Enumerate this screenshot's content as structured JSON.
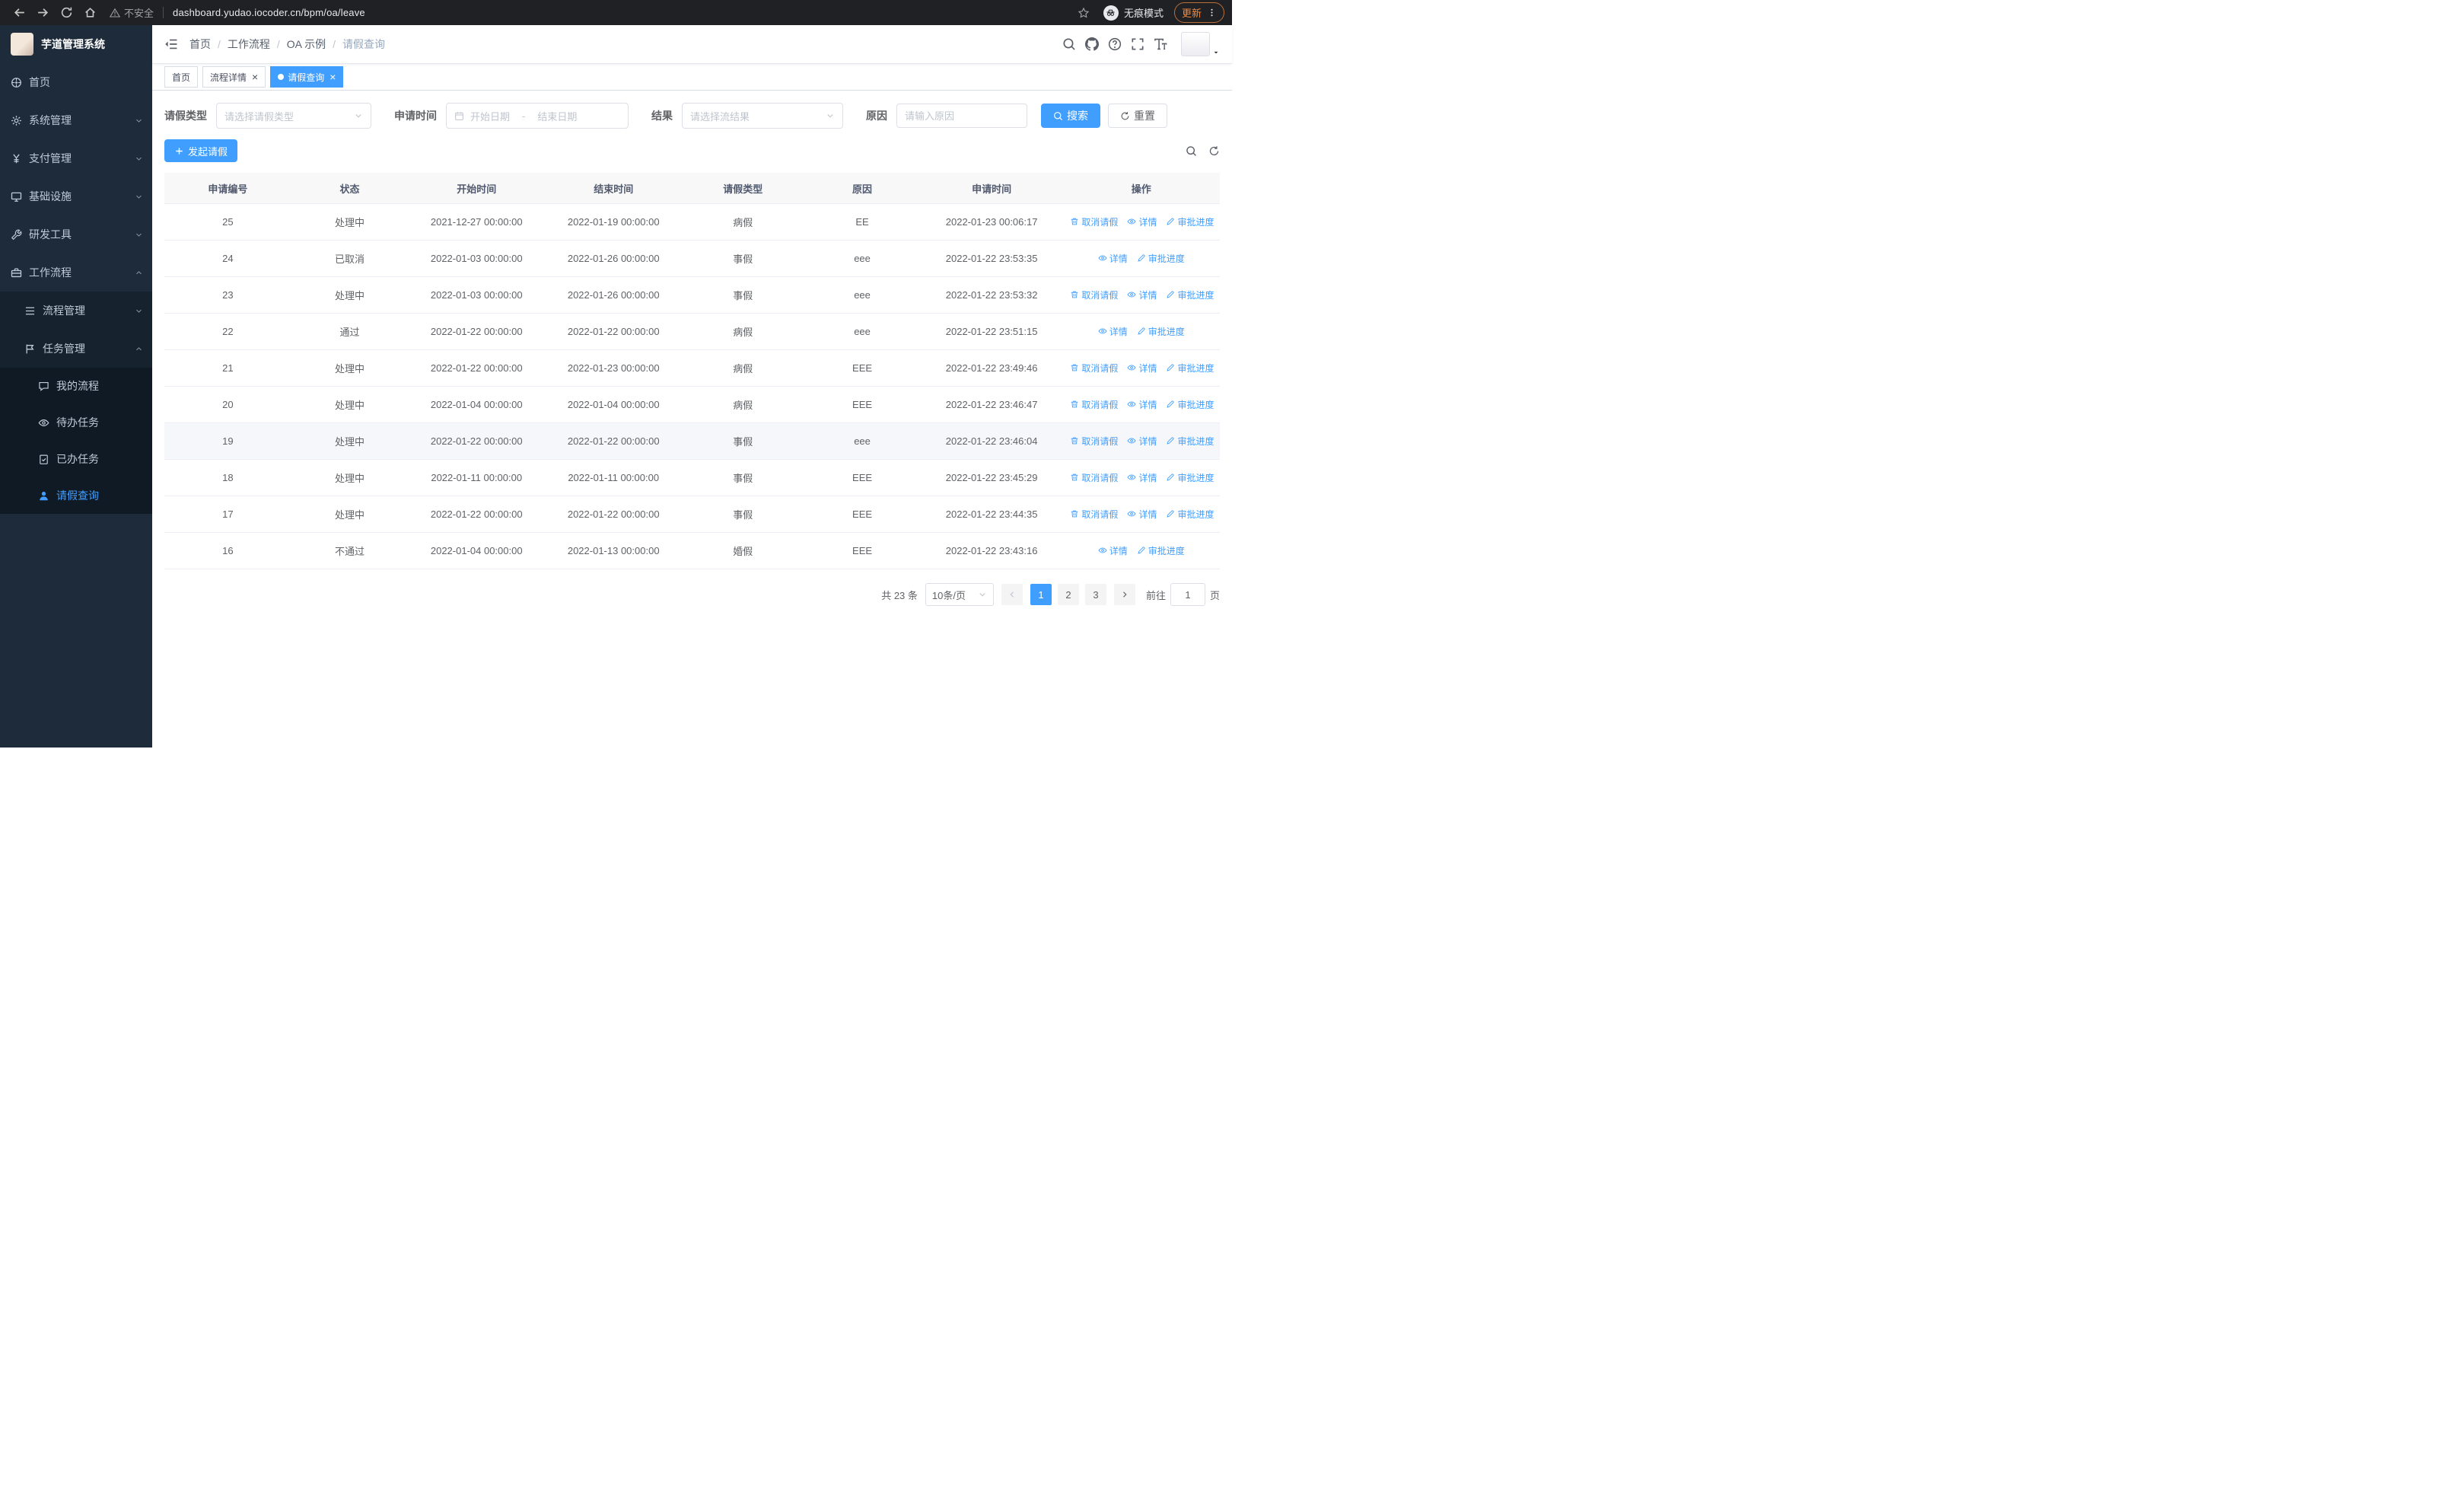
{
  "browser": {
    "security_warning": "不安全",
    "url": "dashboard.yudao.iocoder.cn/bpm/oa/leave",
    "incognito_label": "无痕模式",
    "update_label": "更新"
  },
  "sidebar": {
    "logo_title": "芋道管理系统",
    "items": [
      {
        "key": "home",
        "label": "首页",
        "icon": "dashboard-icon",
        "level": 1
      },
      {
        "key": "system",
        "label": "系统管理",
        "icon": "gear-icon",
        "level": 1,
        "expandable": true,
        "expanded": false
      },
      {
        "key": "payment",
        "label": "支付管理",
        "icon": "yen-icon",
        "level": 1,
        "expandable": true,
        "expanded": false
      },
      {
        "key": "infrastructure",
        "label": "基础设施",
        "icon": "monitor-icon",
        "level": 1,
        "expandable": true,
        "expanded": false
      },
      {
        "key": "dev-tools",
        "label": "研发工具",
        "icon": "wrench-icon",
        "level": 1,
        "expandable": true,
        "expanded": false
      },
      {
        "key": "workflow",
        "label": "工作流程",
        "icon": "briefcase-icon",
        "level": 1,
        "expandable": true,
        "expanded": true
      },
      {
        "key": "process-management",
        "label": "流程管理",
        "icon": "list-icon",
        "level": 2,
        "expandable": true,
        "expanded": false
      },
      {
        "key": "task-management",
        "label": "任务管理",
        "icon": "flag-icon",
        "level": 2,
        "expandable": true,
        "expanded": true
      },
      {
        "key": "my-process",
        "label": "我的流程",
        "icon": "chat-icon",
        "level": 3
      },
      {
        "key": "todo-tasks",
        "label": "待办任务",
        "icon": "eye-icon",
        "level": 3
      },
      {
        "key": "done-tasks",
        "label": "已办任务",
        "icon": "clipboard-check-icon",
        "level": 3
      },
      {
        "key": "leave-query",
        "label": "请假查询",
        "icon": "user-icon",
        "level": 3,
        "active": true
      }
    ]
  },
  "header": {
    "breadcrumb": [
      "首页",
      "工作流程",
      "OA 示例",
      "请假查询"
    ]
  },
  "tabs": [
    {
      "label": "首页",
      "closable": false,
      "active": false
    },
    {
      "label": "流程详情",
      "closable": true,
      "active": false
    },
    {
      "label": "请假查询",
      "closable": true,
      "active": true
    }
  ],
  "filters": {
    "leave_type_label": "请假类型",
    "leave_type_placeholder": "请选择请假类型",
    "apply_time_label": "申请时间",
    "start_date_placeholder": "开始日期",
    "range_separator": "-",
    "end_date_placeholder": "结束日期",
    "result_label": "结果",
    "result_placeholder": "请选择流结果",
    "reason_label": "原因",
    "reason_placeholder": "请输入原因",
    "search_label": "搜索",
    "reset_label": "重置"
  },
  "toolbar": {
    "create_label": "发起请假"
  },
  "table": {
    "headers": [
      "申请编号",
      "状态",
      "开始时间",
      "结束时间",
      "请假类型",
      "原因",
      "申请时间",
      "操作"
    ],
    "actions": {
      "cancel": "取消请假",
      "detail": "详情",
      "progress": "审批进度"
    },
    "rows": [
      {
        "id": "25",
        "status": "处理中",
        "start": "2021-12-27 00:00:00",
        "end": "2022-01-19 00:00:00",
        "type": "病假",
        "reason": "EE",
        "applied": "2022-01-23 00:06:17",
        "can_cancel": true
      },
      {
        "id": "24",
        "status": "已取消",
        "start": "2022-01-03 00:00:00",
        "end": "2022-01-26 00:00:00",
        "type": "事假",
        "reason": "eee",
        "applied": "2022-01-22 23:53:35",
        "can_cancel": false
      },
      {
        "id": "23",
        "status": "处理中",
        "start": "2022-01-03 00:00:00",
        "end": "2022-01-26 00:00:00",
        "type": "事假",
        "reason": "eee",
        "applied": "2022-01-22 23:53:32",
        "can_cancel": true
      },
      {
        "id": "22",
        "status": "通过",
        "start": "2022-01-22 00:00:00",
        "end": "2022-01-22 00:00:00",
        "type": "病假",
        "reason": "eee",
        "applied": "2022-01-22 23:51:15",
        "can_cancel": false
      },
      {
        "id": "21",
        "status": "处理中",
        "start": "2022-01-22 00:00:00",
        "end": "2022-01-23 00:00:00",
        "type": "病假",
        "reason": "EEE",
        "applied": "2022-01-22 23:49:46",
        "can_cancel": true
      },
      {
        "id": "20",
        "status": "处理中",
        "start": "2022-01-04 00:00:00",
        "end": "2022-01-04 00:00:00",
        "type": "病假",
        "reason": "EEE",
        "applied": "2022-01-22 23:46:47",
        "can_cancel": true
      },
      {
        "id": "19",
        "status": "处理中",
        "start": "2022-01-22 00:00:00",
        "end": "2022-01-22 00:00:00",
        "type": "事假",
        "reason": "eee",
        "applied": "2022-01-22 23:46:04",
        "can_cancel": true,
        "highlight": true
      },
      {
        "id": "18",
        "status": "处理中",
        "start": "2022-01-11 00:00:00",
        "end": "2022-01-11 00:00:00",
        "type": "事假",
        "reason": "EEE",
        "applied": "2022-01-22 23:45:29",
        "can_cancel": true
      },
      {
        "id": "17",
        "status": "处理中",
        "start": "2022-01-22 00:00:00",
        "end": "2022-01-22 00:00:00",
        "type": "事假",
        "reason": "EEE",
        "applied": "2022-01-22 23:44:35",
        "can_cancel": true
      },
      {
        "id": "16",
        "status": "不通过",
        "start": "2022-01-04 00:00:00",
        "end": "2022-01-13 00:00:00",
        "type": "婚假",
        "reason": "EEE",
        "applied": "2022-01-22 23:43:16",
        "can_cancel": false
      }
    ]
  },
  "pagination": {
    "total_text": "共 23 条",
    "page_size": "10条/页",
    "pages": [
      "1",
      "2",
      "3"
    ],
    "active_page": "1",
    "goto_label": "前往",
    "goto_value": "1",
    "goto_suffix": "页"
  }
}
